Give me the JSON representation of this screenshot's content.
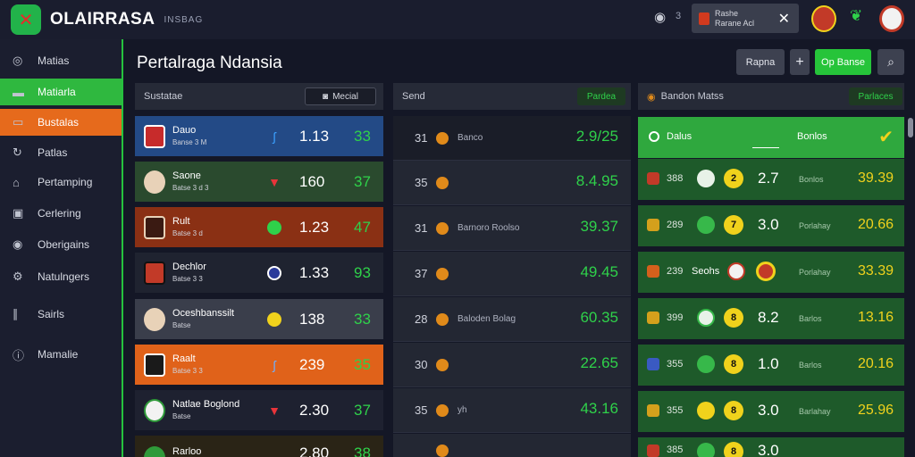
{
  "header": {
    "brand": "OLAIRRASA",
    "subtitle": "INSBAG",
    "notification": {
      "line1": "Rashe",
      "line2": "Rarane Acl"
    }
  },
  "sidebar": {
    "items": [
      {
        "label": "Matias",
        "icon": "location-icon"
      },
      {
        "label": "Matiarla",
        "icon": "flag-icon"
      },
      {
        "label": "Bustalas",
        "icon": "box-icon"
      },
      {
        "label": "Patlas",
        "icon": "refresh-icon"
      },
      {
        "label": "Pertamping",
        "icon": "home-icon"
      },
      {
        "label": "Cerlering",
        "icon": "monitor-icon"
      },
      {
        "label": "Oberigains",
        "icon": "coin-icon"
      },
      {
        "label": "Natulngers",
        "icon": "settings-icon"
      },
      {
        "label": "Sairls",
        "icon": "link-icon"
      },
      {
        "label": "Mamalie",
        "icon": "info-icon"
      }
    ]
  },
  "page": {
    "title": "Pertalraga Ndansia"
  },
  "toolbar": {
    "filter_label": "Rapna",
    "plus_label": "+",
    "action_label": "Op Banse"
  },
  "left_panel": {
    "header": "Sustatae",
    "dropdown": "Mecial",
    "rows": [
      {
        "team": "Dauo",
        "sub": "Banse 3 M",
        "v1": "1.13",
        "v2": "33",
        "bg": "#234a86",
        "crest": "#c72b2b"
      },
      {
        "team": "Saone",
        "sub": "Batse 3 d 3",
        "v1": "160",
        "v2": "37",
        "bg": "#2a4a2e",
        "crest": "#3b2a20"
      },
      {
        "team": "Rult",
        "sub": "Batse 3 d",
        "v1": "1.23",
        "v2": "47",
        "bg": "#8a3014",
        "crest": "#3a1a12"
      },
      {
        "team": "Dechlor",
        "sub": "Batse 3 3",
        "v1": "1.33",
        "v2": "93",
        "bg": "#1f2330",
        "crest": "#c23a28"
      },
      {
        "team": "Oceshbanssilt",
        "sub": "Batse",
        "v1": "138",
        "v2": "33",
        "bg": "#3a3e4b",
        "crest": "#3a2a22"
      },
      {
        "team": "Raalt",
        "sub": "Batse 3 3",
        "v1": "239",
        "v2": "35",
        "bg": "#e0621a",
        "crest": "#1a1a1a"
      },
      {
        "team": "Natlae Boglond",
        "sub": "Batse",
        "v1": "2.30",
        "v2": "37",
        "bg": "#1e2130",
        "crest": "#f2f2f2"
      },
      {
        "team": "Rarloo",
        "sub": "",
        "v1": "2.80",
        "v2": "38",
        "bg": "#2a2416",
        "crest": "#2f9a3a"
      }
    ]
  },
  "middle_panel": {
    "header": "Send",
    "pill": "Pardea",
    "rows": [
      {
        "num": "31",
        "label": "Banco",
        "odd": "2.9/25"
      },
      {
        "num": "35",
        "label": "",
        "odd": "8.4.95"
      },
      {
        "num": "31",
        "label": "Barnoro Roolso",
        "odd": "39.37"
      },
      {
        "num": "37",
        "label": "",
        "odd": "49.45"
      },
      {
        "num": "28",
        "label": "Baloden Bolag",
        "odd": "60.35"
      },
      {
        "num": "30",
        "label": "",
        "odd": "22.65"
      },
      {
        "num": "35",
        "label": "yh",
        "odd": "43.16"
      },
      {
        "num": "",
        "label": "",
        "odd": ""
      }
    ]
  },
  "right_panel": {
    "header": "Bandon Matss",
    "pill": "Parlaces",
    "highlight": {
      "left": "Dalus",
      "right": "Bonlos"
    },
    "rows": [
      {
        "n": "388",
        "c2": "2",
        "s": "2.7",
        "t": "Bonlos",
        "o": "39.39",
        "flag": "#c23a28"
      },
      {
        "n": "289",
        "c2": "7",
        "s": "3.0",
        "t": "Porlahay",
        "o": "20.66",
        "flag": "#d4a01c"
      },
      {
        "n": "239",
        "c2": "",
        "s": "Seohs",
        "t": "Porlahay",
        "o": "33.39",
        "flag": "#d4601c"
      },
      {
        "n": "399",
        "c2": "8",
        "s": "8.2",
        "t": "Barlos",
        "o": "13.16",
        "flag": "#d4a01c"
      },
      {
        "n": "355",
        "c2": "8",
        "s": "1.0",
        "t": "Barlos",
        "o": "20.16",
        "flag": "#3a5ac2"
      },
      {
        "n": "355",
        "c2": "8",
        "s": "3.0",
        "t": "Barlahay",
        "o": "25.96",
        "flag": "#d4a01c"
      },
      {
        "n": "385",
        "c2": "8",
        "s": "3.0",
        "t": "",
        "o": "",
        "flag": "#c23a28"
      }
    ]
  }
}
